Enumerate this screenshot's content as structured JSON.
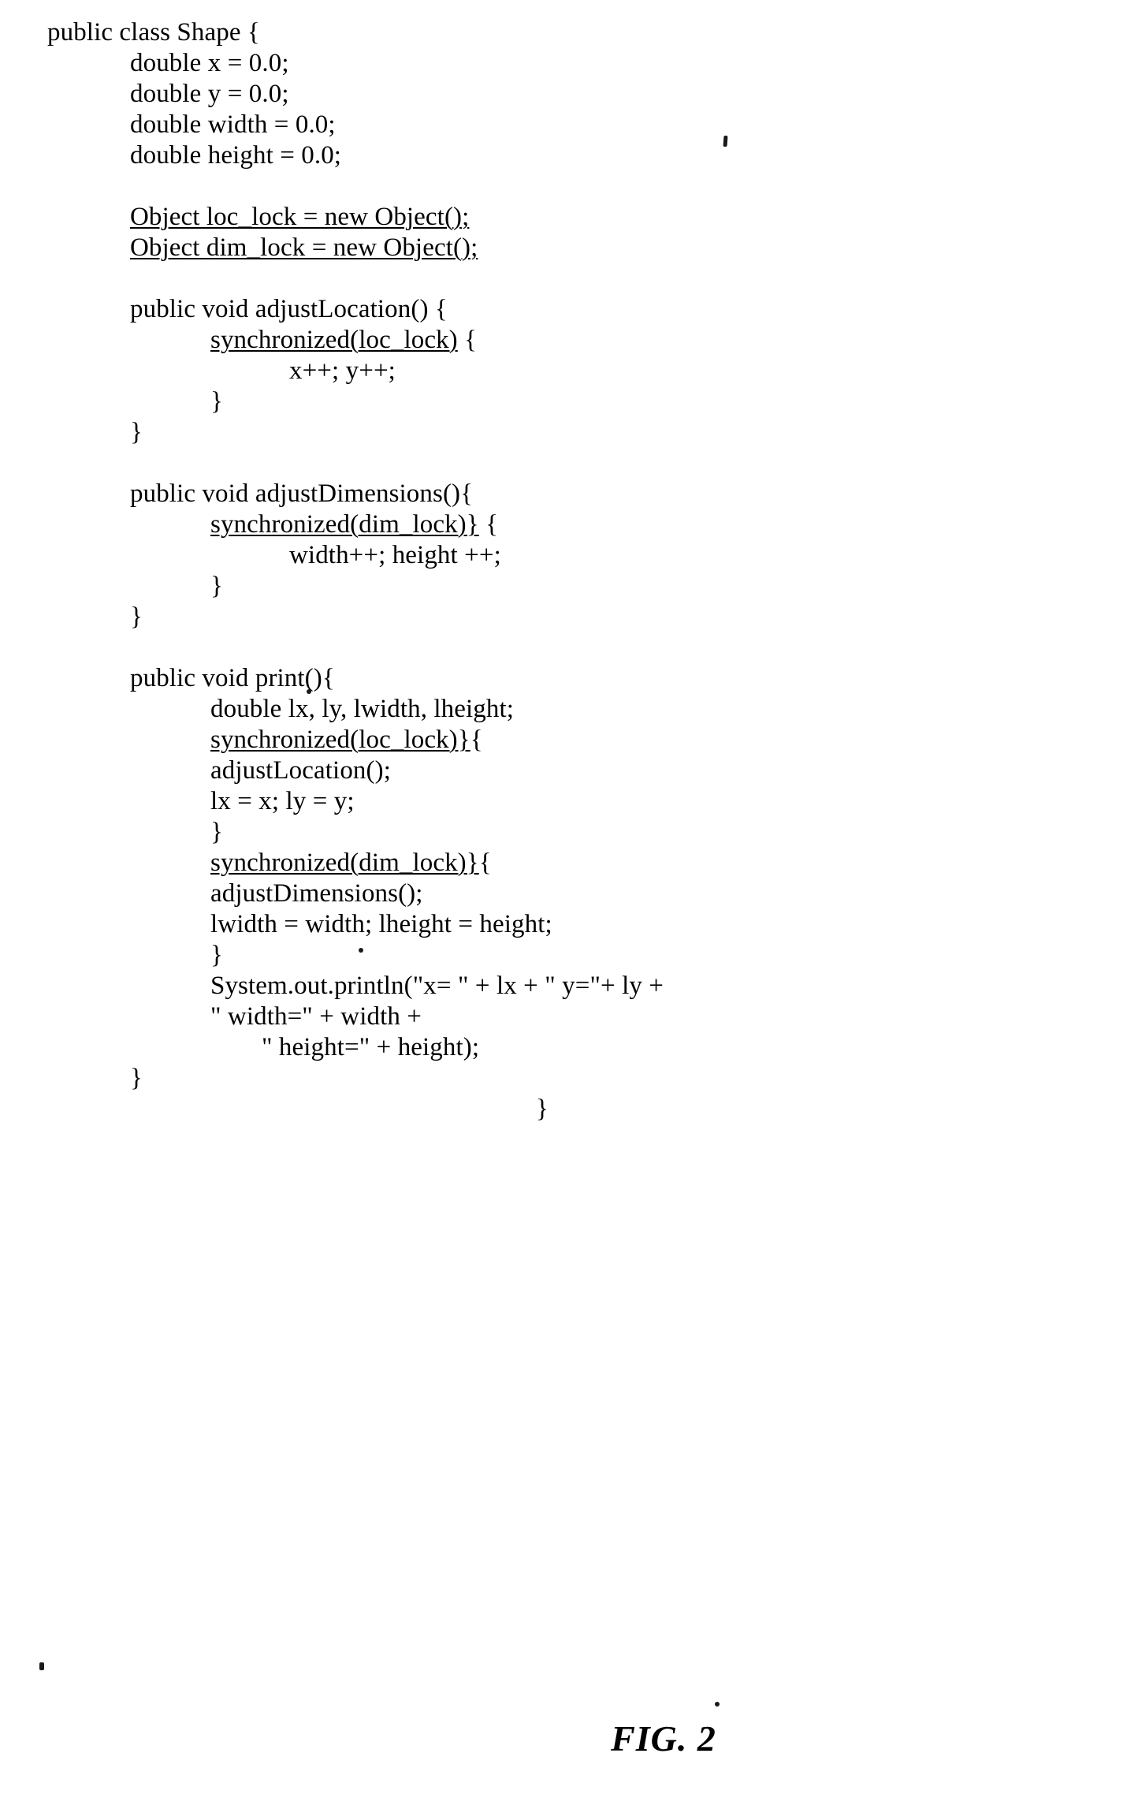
{
  "figure": {
    "caption": "FIG. 2",
    "language": "Java",
    "class_name": "Shape"
  },
  "code": {
    "lines": [
      {
        "indent": 0,
        "segments": [
          {
            "text": "public class Shape {",
            "underline": false
          }
        ]
      },
      {
        "indent": 1,
        "segments": [
          {
            "text": "double x = 0.0;",
            "underline": false
          }
        ]
      },
      {
        "indent": 1,
        "segments": [
          {
            "text": "double y = 0.0;",
            "underline": false
          }
        ]
      },
      {
        "indent": 1,
        "segments": [
          {
            "text": "double width = 0.0;",
            "underline": false
          }
        ]
      },
      {
        "indent": 1,
        "segments": [
          {
            "text": "double height = 0.0;",
            "underline": false
          }
        ]
      },
      {
        "indent": 0,
        "blank": true,
        "segments": []
      },
      {
        "indent": 1,
        "segments": [
          {
            "text": "Object loc_lock = new Object();",
            "underline": true
          }
        ]
      },
      {
        "indent": 1,
        "segments": [
          {
            "text": "Object dim_lock = new Object();",
            "underline": true
          }
        ]
      },
      {
        "indent": 0,
        "blank": true,
        "segments": []
      },
      {
        "indent": 1,
        "segments": [
          {
            "text": "public void adjustLocation() {",
            "underline": false
          }
        ]
      },
      {
        "indent": 2,
        "segments": [
          {
            "text": "synchronized(loc_lock)",
            "underline": true
          },
          {
            "text": " {",
            "underline": false
          }
        ]
      },
      {
        "indent": 3,
        "segments": [
          {
            "text": "x++; y++;",
            "underline": false
          }
        ]
      },
      {
        "indent": 2,
        "segments": [
          {
            "text": "}",
            "underline": false
          }
        ]
      },
      {
        "indent": 1,
        "segments": [
          {
            "text": "}",
            "underline": false
          }
        ]
      },
      {
        "indent": 0,
        "blank": true,
        "segments": []
      },
      {
        "indent": 1,
        "segments": [
          {
            "text": "public void adjustDimensions(){",
            "underline": false
          }
        ]
      },
      {
        "indent": 2,
        "segments": [
          {
            "text": "synchronized(dim_lock)}",
            "underline": true
          },
          {
            "text": " {",
            "underline": false
          }
        ]
      },
      {
        "indent": 3,
        "segments": [
          {
            "text": "width++; height ++;",
            "underline": false
          }
        ]
      },
      {
        "indent": 2,
        "segments": [
          {
            "text": "}",
            "underline": false
          }
        ]
      },
      {
        "indent": 1,
        "segments": [
          {
            "text": "}",
            "underline": false
          }
        ]
      },
      {
        "indent": 0,
        "blank": true,
        "segments": []
      },
      {
        "indent": 1,
        "segments": [
          {
            "text": "public void print(){",
            "underline": false
          }
        ]
      },
      {
        "indent": 2,
        "segments": [
          {
            "text": "double lx, ly, lwidth, lheight;",
            "underline": false
          }
        ]
      },
      {
        "indent": 2,
        "segments": [
          {
            "text": "synchronized(loc_lock)}",
            "underline": true
          },
          {
            "text": "{",
            "underline": false
          }
        ]
      },
      {
        "indent": 2,
        "segments": [
          {
            "text": "adjustLocation();",
            "underline": false
          }
        ]
      },
      {
        "indent": 2,
        "segments": [
          {
            "text": "lx = x; ly = y;",
            "underline": false
          }
        ]
      },
      {
        "indent": 2,
        "segments": [
          {
            "text": "}",
            "underline": false
          }
        ]
      },
      {
        "indent": 2,
        "segments": [
          {
            "text": "synchronized(dim_lock)}",
            "underline": true
          },
          {
            "text": "{",
            "underline": false
          }
        ]
      },
      {
        "indent": 2,
        "segments": [
          {
            "text": "adjustDimensions();",
            "underline": false
          }
        ]
      },
      {
        "indent": 2,
        "segments": [
          {
            "text": "lwidth = width; lheight = height;",
            "underline": false
          }
        ]
      },
      {
        "indent": 2,
        "segments": [
          {
            "text": "}",
            "underline": false
          }
        ]
      },
      {
        "indent": 2,
        "segments": [
          {
            "text": "System.out.println(\"x= \" + lx + \" y=\"+ ly +",
            "underline": false
          }
        ]
      },
      {
        "indent": 2,
        "segments": [
          {
            "text": "\" width=\" + width +",
            "underline": false
          }
        ]
      },
      {
        "indent": 4,
        "segments": [
          {
            "text": "\" height=\" + height);",
            "underline": false
          }
        ]
      },
      {
        "indent": 1,
        "segments": [
          {
            "text": "}",
            "underline": false
          }
        ]
      },
      {
        "indent": 5,
        "segments": [
          {
            "text": "}",
            "underline": false
          }
        ]
      }
    ]
  }
}
